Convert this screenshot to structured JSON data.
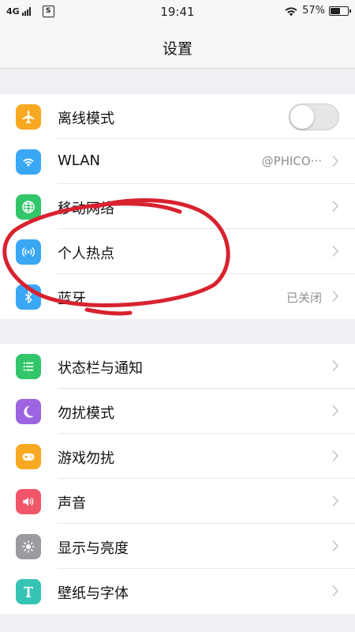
{
  "status_bar": {
    "network": "4G",
    "sim_icon_text": "S",
    "time": "19:41",
    "battery": "57%",
    "battery_level": 0.57
  },
  "nav": {
    "title": "设置"
  },
  "groups": [
    {
      "items": [
        {
          "label": "离线模式",
          "icon": "airplane-icon",
          "icon_color": "#f9a821",
          "toggle": false
        },
        {
          "label": "WLAN",
          "icon": "wifi-icon",
          "icon_color": "#3aa7f5",
          "value": "@PHICO···"
        },
        {
          "label": "移动网络",
          "icon": "globe-icon",
          "icon_color": "#33c56a"
        },
        {
          "label": "个人热点",
          "icon": "hotspot-icon",
          "icon_color": "#3aa7f5"
        },
        {
          "label": "蓝牙",
          "icon": "bluetooth-icon",
          "icon_color": "#3aa7f5",
          "value": "已关闭"
        }
      ]
    },
    {
      "items": [
        {
          "label": "状态栏与通知",
          "icon": "notification-list-icon",
          "icon_color": "#33c56a"
        },
        {
          "label": "勿扰模式",
          "icon": "moon-icon",
          "icon_color": "#9c64e0"
        },
        {
          "label": "游戏勿扰",
          "icon": "gamepad-icon",
          "icon_color": "#f9a821"
        },
        {
          "label": "声音",
          "icon": "speaker-icon",
          "icon_color": "#f2566b"
        },
        {
          "label": "显示与亮度",
          "icon": "brightness-icon",
          "icon_color": "#9b9ba0"
        },
        {
          "label": "壁纸与字体",
          "icon": "font-t-icon",
          "icon_color": "#35c3b4"
        }
      ]
    }
  ],
  "annotation_color": "#d8222f"
}
